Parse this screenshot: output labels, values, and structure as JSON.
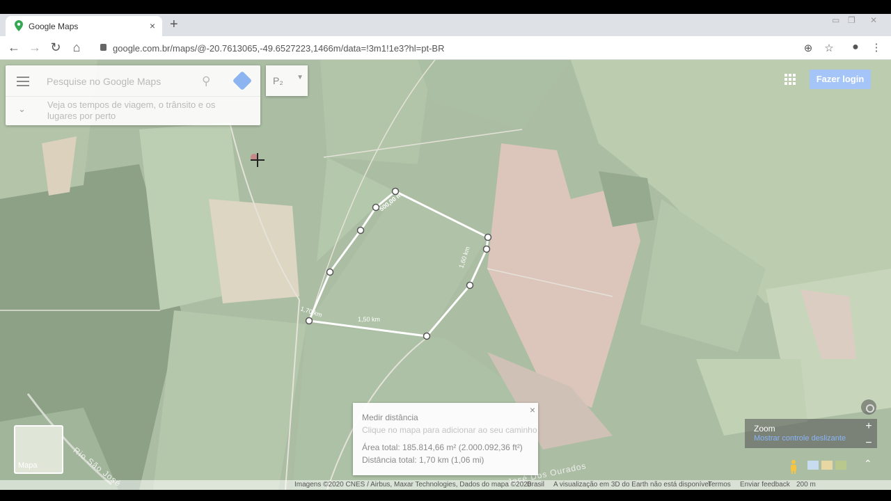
{
  "browser": {
    "tab_title": "Google Maps",
    "close_glyph": "×",
    "new_tab_glyph": "+",
    "url": "google.com.br/maps/@-20.7613065,-49.6527223,1466m/data=!3m1!1e3?hl=pt-BR",
    "nav": {
      "back": "←",
      "forward": "→",
      "reload": "↻",
      "home": "⌂"
    }
  },
  "search": {
    "placeholder": "Pesquise no Google Maps",
    "hint": "Veja os tempos de viagem, o trânsito e os lugares por perto",
    "layer_label": "P₂",
    "dropdown_glyph": "▼",
    "expand_glyph": "⌄",
    "search_glyph": "⚲"
  },
  "header": {
    "login_label": "Fazer login"
  },
  "measure_panel": {
    "title": "Medir distância",
    "subtitle": "Clique no mapa para adicionar ao seu caminho",
    "area": "Área total: 185.814,66 m² (2.000.092,36 ft²)",
    "distance": "Distância total: 1,70 km (1,06 mi)",
    "close_glyph": "×"
  },
  "path_labels": {
    "seg1": "500,00 m",
    "seg2": "1,60 km",
    "seg3": "1,50 km",
    "seg4": "1,70 km"
  },
  "minimap": {
    "label": "Mapa"
  },
  "zoom": {
    "title": "Zoom",
    "link": "Mostrar controle deslizante",
    "plus": "+",
    "minus": "−",
    "expand_glyph": "⌃"
  },
  "streets": {
    "rio": "Rio São José",
    "jose": "José Dos Ourados"
  },
  "footer": {
    "imagery": "Imagens ©2020 CNES / Airbus, Maxar Technologies, Dados do mapa ©2020",
    "country": "Brasil",
    "earth_note": "A visualização em 3D do Earth não está disponível",
    "terms": "Termos",
    "feedback": "Enviar feedback",
    "scale": "200 m"
  },
  "colors": {
    "accent": "#8ab4f8",
    "login_bg": "#a5c4f8",
    "path": "#ffffff"
  }
}
